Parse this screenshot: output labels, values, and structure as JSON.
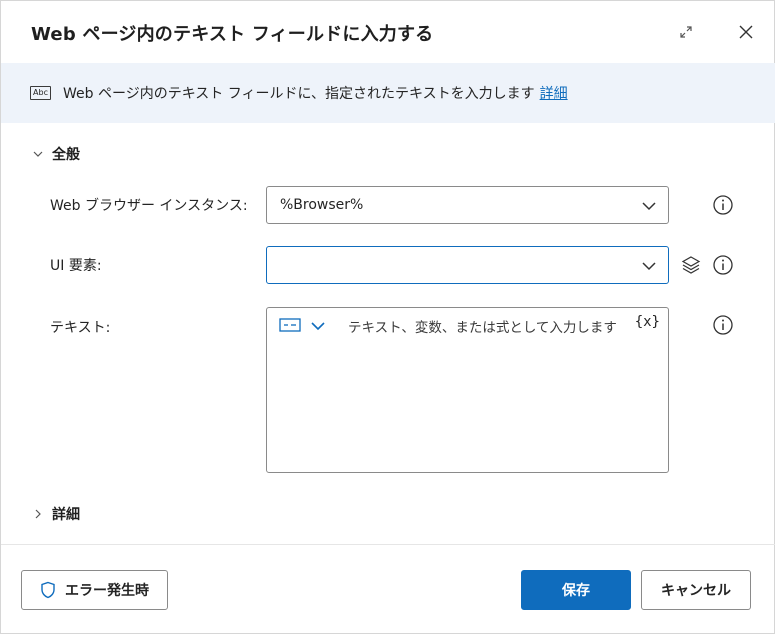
{
  "dialog": {
    "title": "Web ページ内のテキスト フィールドに入力する"
  },
  "banner": {
    "icon": "abc-icon",
    "icon_text": "Abc",
    "description": "Web ページ内のテキスト フィールドに、指定されたテキストを入力します",
    "link": "詳細"
  },
  "sections": {
    "general": "全般",
    "details": "詳細"
  },
  "fields": {
    "browser_instance": {
      "label": "Web ブラウザー インスタンス:",
      "value": "%Browser%"
    },
    "ui_element": {
      "label": "UI 要素:",
      "value": ""
    },
    "text": {
      "label": "テキスト:",
      "placeholder": "テキスト、変数、または式として入力します",
      "variable_button": "{x}"
    }
  },
  "footer": {
    "on_error": "エラー発生時",
    "save": "保存",
    "cancel": "キャンセル"
  },
  "colors": {
    "accent": "#0f6cbd",
    "banner_bg": "#eef3fa"
  }
}
